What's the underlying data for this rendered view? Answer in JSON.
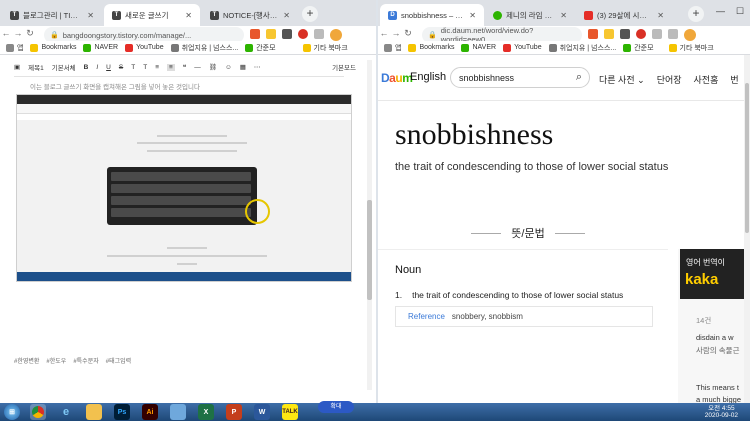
{
  "left_window": {
    "tabs": [
      {
        "title": "블로그관리 | TISTORY",
        "active": false
      },
      {
        "title": "새로운 글쓰기",
        "active": true
      },
      {
        "title": "NOTICE-[행사] ★모이면",
        "active": false
      }
    ],
    "url": "bangdoongstory.tistory.com/manage/...",
    "bookmarks": [
      "앱",
      "Bookmarks",
      "NAVER",
      "YouTube",
      "취업지유 | 넘스스...",
      "간준모",
      "기타 북마크"
    ],
    "editor": {
      "toolbar": {
        "title_style": "제목1",
        "font": "기본서체",
        "bold": "B",
        "italic": "I",
        "underline": "U",
        "strike": "S",
        "more": "기본모드"
      },
      "faint_text": "이는 블로그 글쓰기 화면을 캡쳐해온 그림을 넣어 놓은 것입니다",
      "tags": [
        "#한영변환",
        "#한도우",
        "#특수문자",
        "#태그입력"
      ]
    },
    "pill_label": "확대"
  },
  "right_window": {
    "tabs": [
      {
        "title": "snobbishness – 다음 영어사전",
        "active": true
      },
      {
        "title": "제니의 라임 요가 릴러",
        "active": false
      },
      {
        "title": "(3) 29살에 시작한 경매",
        "active": false
      }
    ],
    "url": "dic.daum.net/word/view.do?wordid=eew0...",
    "bookmarks": [
      "앱",
      "Bookmarks",
      "NAVER",
      "YouTube",
      "취업지유 | 넘스스...",
      "간준모",
      "기타 북마크"
    ],
    "header": {
      "logo": "Daum",
      "title": "English",
      "search_value": "snobbishness",
      "menu": [
        "다른 사전",
        "단어장",
        "사전홈",
        "번"
      ]
    },
    "entry": {
      "word": "snobbishness",
      "short_def": "the trait of condescending to those of lower social status",
      "section_title": "뜻/문법",
      "pos": "Noun",
      "meanings": [
        {
          "num": "1.",
          "text": "the trait of condescending to those of lower social status"
        }
      ],
      "reference_label": "Reference",
      "reference_value": "snobbery, snobbism"
    },
    "side": {
      "ad_line1": "영어 번역이",
      "ad_line2": "kaka",
      "count": "14건",
      "text1": "disdain a w",
      "text2": "사람의 속물근",
      "text3": "This means t",
      "text4": "a much bigge"
    }
  },
  "taskbar": {
    "time": "오전 4:55",
    "date": "2020-09-02"
  }
}
